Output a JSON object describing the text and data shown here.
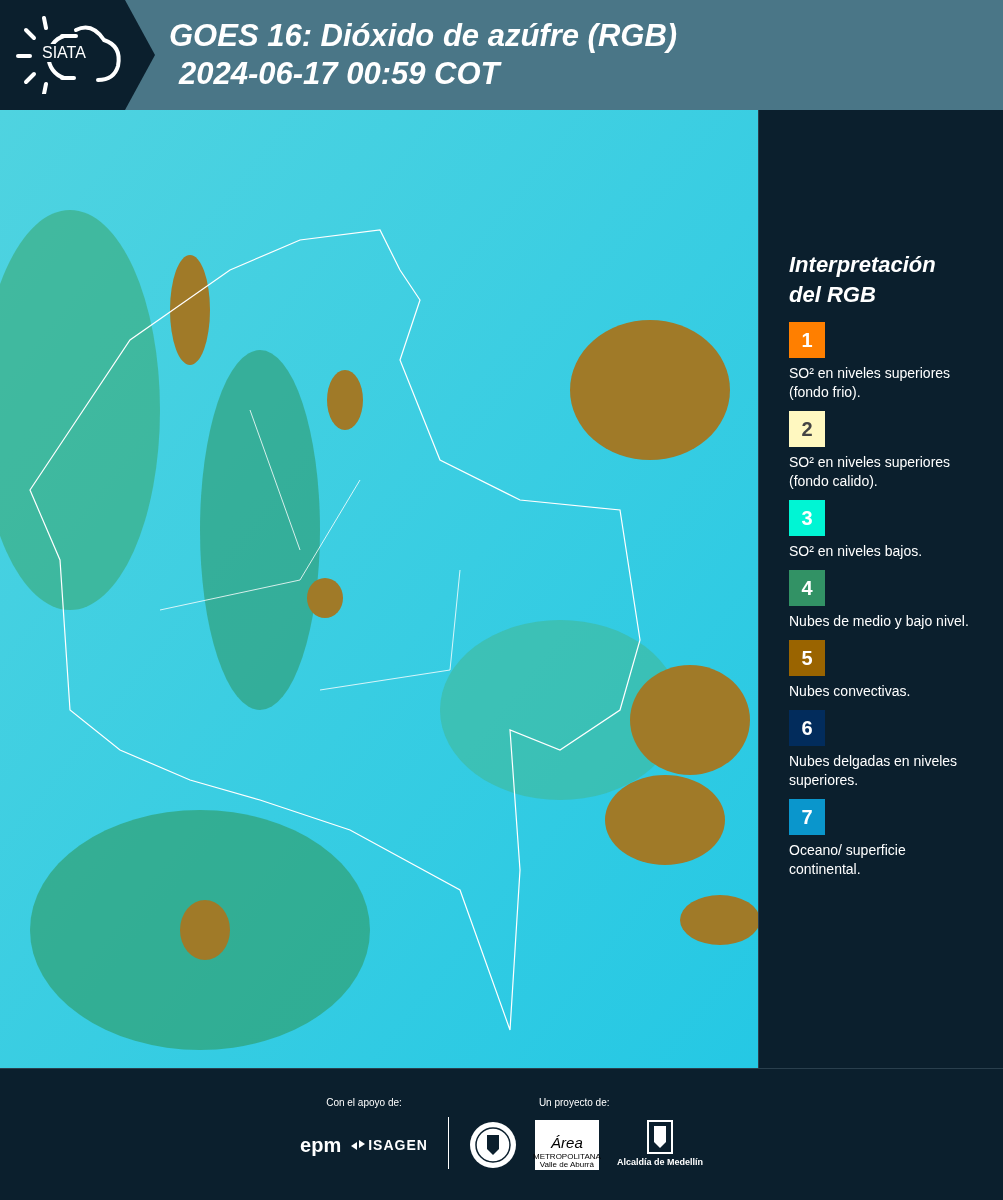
{
  "header": {
    "logo_text": "SIATA",
    "title": "GOES 16: Dióxido de azúfre (RGB)",
    "timestamp": "2024-06-17 00:59 COT"
  },
  "legend": {
    "title_lines": [
      "Interpretación",
      "del RGB"
    ],
    "items": [
      {
        "number": "1",
        "color": "#ff7f00",
        "text": "SO² en niveles superiores (fondo frio)."
      },
      {
        "number": "2",
        "color": "#fff8c0",
        "text": "SO² en niveles superiores (fondo calido)."
      },
      {
        "number": "3",
        "color": "#00f5d4",
        "text": "SO² en niveles bajos."
      },
      {
        "number": "4",
        "color": "#329265",
        "text": "Nubes de medio y bajo nivel."
      },
      {
        "number": "5",
        "color": "#9a6400",
        "text": "Nubes convectivas."
      },
      {
        "number": "6",
        "color": "#022c5c",
        "text": "Nubes delgadas en niveles superiores."
      },
      {
        "number": "7",
        "color": "#0a96cc",
        "text": "Oceano/ superficie continental."
      }
    ]
  },
  "footer": {
    "support_label": "Con el apoyo de:",
    "project_label": "Un proyecto de:",
    "epm": "epm",
    "isagen": "ISAGEN",
    "area": "Área",
    "metropolitana": "METROPOLITANA",
    "valle": "Valle de Aburrá",
    "alcaldia": "Alcaldía de Medellín"
  }
}
